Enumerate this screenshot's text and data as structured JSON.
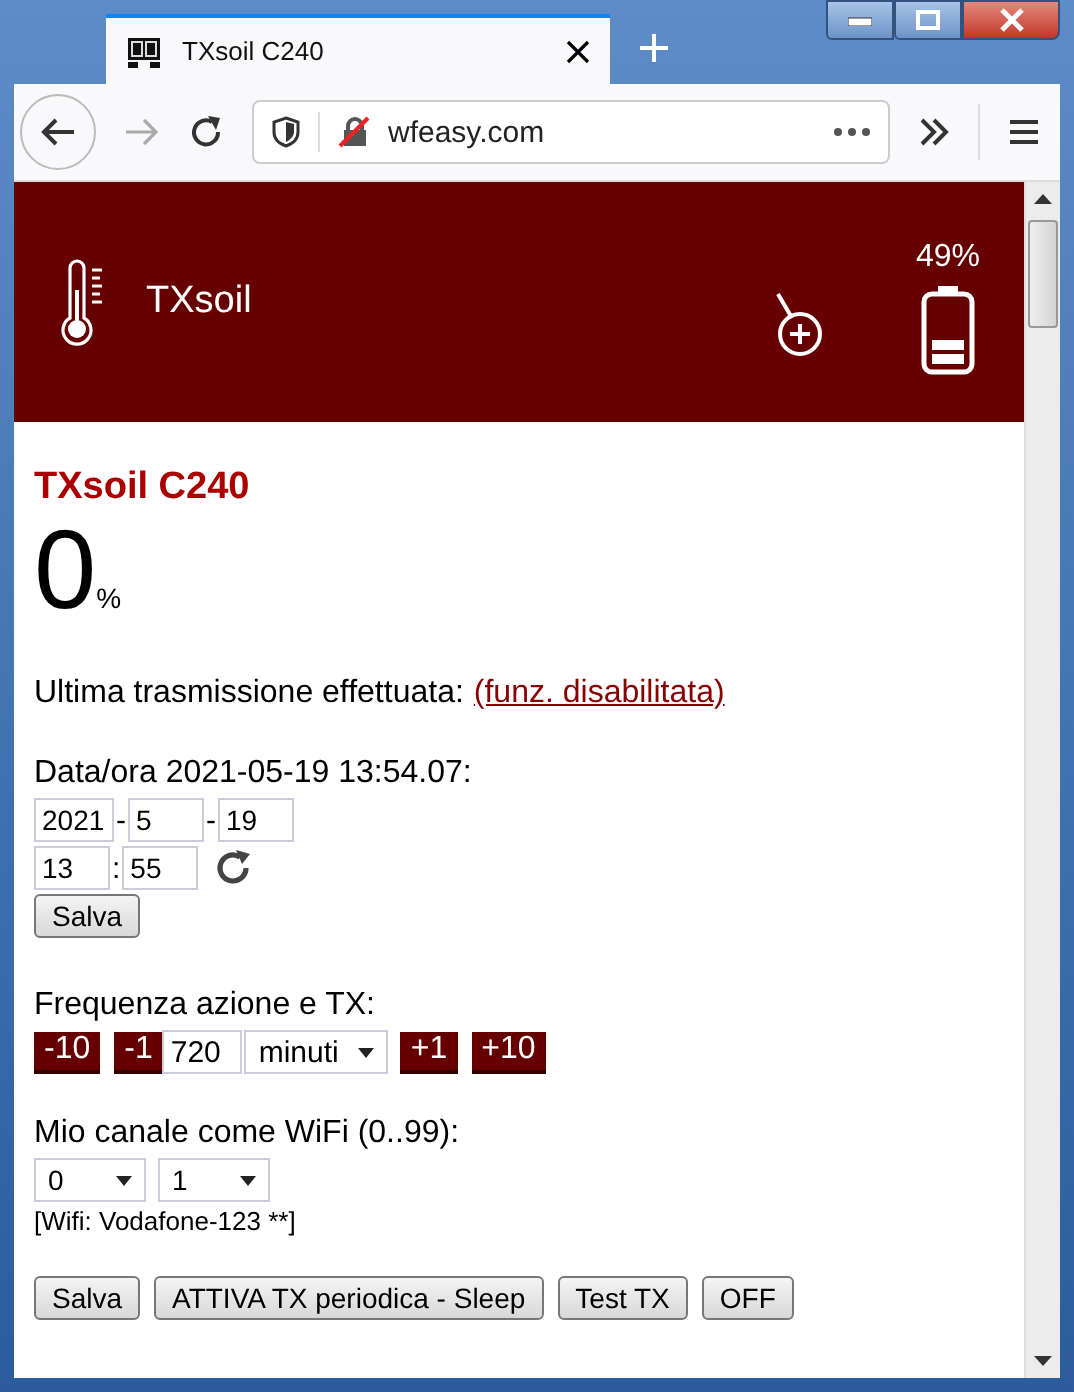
{
  "browser": {
    "tab_title": "TXsoil C240",
    "url": "wfeasy.com"
  },
  "header": {
    "title": "TXsoil",
    "battery": "49%"
  },
  "device": {
    "title": "TXsoil C240",
    "value": "0",
    "unit": "%"
  },
  "last_tx": {
    "label": "Ultima trasmissione effettuata:",
    "link": "(funz. disabilitata)"
  },
  "datetime": {
    "label": "Data/ora 2021-05-19 13:54.07:",
    "date": [
      "2021",
      "5",
      "19"
    ],
    "date_sep": [
      "-",
      "-"
    ],
    "time": [
      "13",
      "55"
    ],
    "time_sep": ":",
    "save": "Salva"
  },
  "frequency": {
    "label": "Frequenza azione e TX:",
    "controls": [
      {
        "kind": "step",
        "label": "-10"
      },
      {
        "kind": "step",
        "label": "-1"
      },
      {
        "kind": "input",
        "label": "720"
      },
      {
        "kind": "select",
        "label": "minuti"
      },
      {
        "kind": "step",
        "label": "+1"
      },
      {
        "kind": "step",
        "label": "+10"
      }
    ]
  },
  "channel": {
    "label": "Mio canale come WiFi (0..99):",
    "selects": [
      "0",
      "1"
    ],
    "note": "[Wifi: Vodafone-123 **]"
  },
  "buttons": [
    "Salva",
    "ATTIVA TX periodica - Sleep",
    "Test TX",
    "OFF"
  ]
}
